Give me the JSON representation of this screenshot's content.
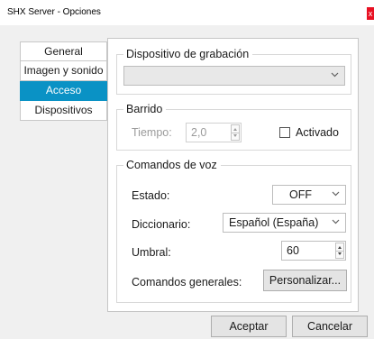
{
  "window": {
    "title": "SHX Server - Opciones",
    "close_glyph": "x"
  },
  "nav": {
    "items": [
      {
        "label": "General"
      },
      {
        "label": "Imagen y sonido"
      },
      {
        "label": "Acceso"
      },
      {
        "label": "Dispositivos"
      }
    ],
    "active_index": 2,
    "active_color": "#0a92c5"
  },
  "recording": {
    "legend": "Dispositivo de grabación",
    "selected": ""
  },
  "sweep": {
    "legend": "Barrido",
    "time_label": "Tiempo:",
    "time_value": "2,0",
    "enabled_label": "Activado",
    "enabled_checked": false
  },
  "voice": {
    "legend": "Comandos de voz",
    "state_label": "Estado:",
    "state_value": "OFF",
    "dict_label": "Diccionario:",
    "dict_value": "Español (España)",
    "threshold_label": "Umbral:",
    "threshold_value": "60",
    "general_label": "Comandos generales:",
    "customize_button": "Personalizar..."
  },
  "footer": {
    "accept_button": "Aceptar",
    "cancel_button": "Cancelar"
  }
}
